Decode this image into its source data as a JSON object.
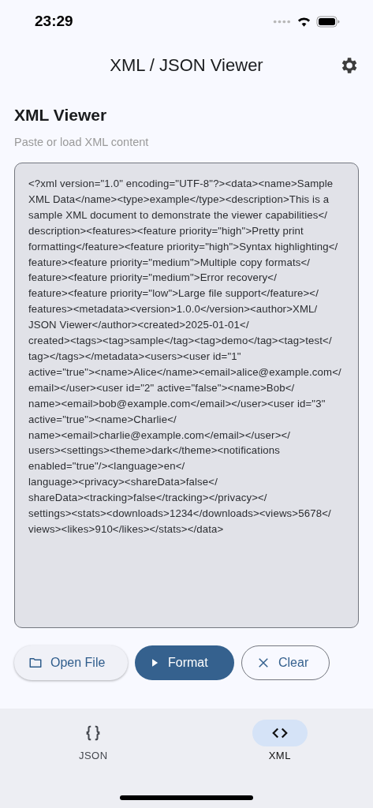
{
  "status_bar": {
    "time": "23:29"
  },
  "app_bar": {
    "title": "XML / JSON Viewer"
  },
  "section": {
    "title": "XML Viewer",
    "hint": "Paste or load XML content"
  },
  "editor": {
    "value": "<?xml version=\"1.0\" encoding=\"UTF-8\"?><data><name>Sample XML Data</name><type>example</type><description>This is a sample XML document to demonstrate the viewer capabilities</description><features><feature priority=\"high\">Pretty print formatting</feature><feature priority=\"high\">Syntax highlighting</feature><feature priority=\"medium\">Multiple copy formats</feature><feature priority=\"medium\">Error recovery</feature><feature priority=\"low\">Large file support</feature></features><metadata><version>1.0.0</version><author>XML/JSON Viewer</author><created>2025-01-01</created><tags><tag>sample</tag><tag>demo</tag><tag>test</tag></tags></metadata><users><user id=\"1\" active=\"true\"><name>Alice</name><email>alice@example.com</email></user><user id=\"2\" active=\"false\"><name>Bob</name><email>bob@example.com</email></user><user id=\"3\" active=\"true\"><name>Charlie</name><email>charlie@example.com</email></user></users><settings><theme>dark</theme><notifications enabled=\"true\"/><language>en</language><privacy><shareData>false</shareData><tracking>false</tracking></privacy></settings><stats><downloads>1234</downloads><views>5678</views><likes>910</likes></stats></data>"
  },
  "buttons": [
    {
      "label": "Open File",
      "kind": "tonal"
    },
    {
      "label": "Format",
      "kind": "filled"
    },
    {
      "label": "Clear",
      "kind": "outlined"
    }
  ],
  "nav": [
    {
      "label": "JSON",
      "selected": false
    },
    {
      "label": "XML",
      "selected": true
    }
  ]
}
